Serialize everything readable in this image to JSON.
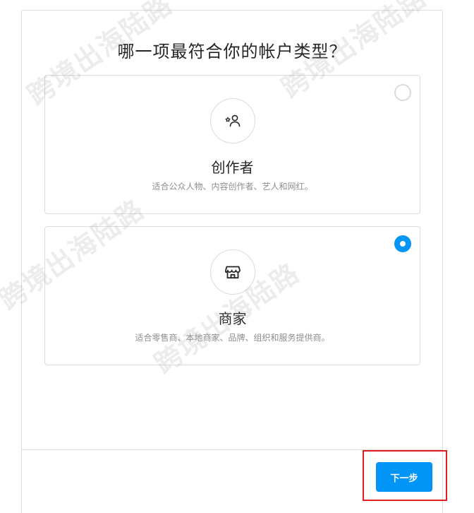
{
  "dialog": {
    "title": "哪一项最符合你的帐户类型？"
  },
  "options": [
    {
      "id": "creator",
      "title": "创作者",
      "description": "适合公众人物、内容创作者、艺人和网红。",
      "icon": "creator-star-person-icon",
      "selected": false
    },
    {
      "id": "business",
      "title": "商家",
      "description": "适合零售商、本地商家、品牌、组织和服务提供商。",
      "icon": "storefront-icon",
      "selected": true
    }
  ],
  "footer": {
    "next_label": "下一步"
  },
  "watermark": {
    "text_1": "跨境出海陆路",
    "text_2": "跨境出海陆路",
    "text_3": "跨境出海陆路",
    "text_4": "跨境出海陆路"
  },
  "colors": {
    "accent": "#0095f6",
    "border": "#dbdbdb",
    "highlight": "#e02020"
  }
}
